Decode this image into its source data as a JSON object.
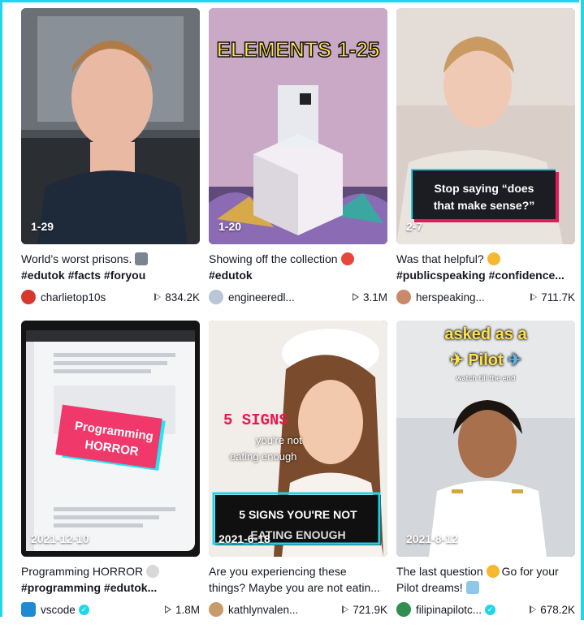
{
  "videos": [
    {
      "overlay": "1-29",
      "desc": "World’s worst prisons.",
      "tags": "#edutok #facts #foryou",
      "author": "charlietop10s",
      "views": "834.2K",
      "verified": false
    },
    {
      "overlay": "1-20",
      "thumb_title": "ELEMENTS 1-25",
      "desc": "Showing off the collection",
      "tags": "#edutok",
      "author": "engineeredl...",
      "views": "3.1M",
      "verified": false
    },
    {
      "overlay": "2-7",
      "thumb_caption_1": "Stop saying “does",
      "thumb_caption_2": "that make sense?”",
      "desc": "Was that helpful?",
      "tags": "#publicspeaking #confidence...",
      "author": "herspeaking...",
      "views": "711.7K",
      "verified": false
    },
    {
      "overlay": "2021-12-10",
      "thumb_caption_1": "Programming",
      "thumb_caption_2": "HORROR",
      "desc": "Programming HORROR",
      "tags": "#programming #edutok...",
      "author": "vscode",
      "views": "1.8M",
      "verified": true
    },
    {
      "overlay": "2021-6-18",
      "thumb_caption_1": "5 SIGNS",
      "thumb_caption_2": "you're not",
      "thumb_caption_3": "eating enough",
      "thumb_caption_4": "5 SIGNS YOU'RE NOT",
      "thumb_caption_5": "EATING ENOUGH",
      "desc": "Are you experiencing these",
      "desc2": "things? Maybe you are not eatin...",
      "author": "kathlynvalen...",
      "views": "721.9K",
      "verified": false
    },
    {
      "overlay": "2021-8-12",
      "thumb_caption_1": "asked as a",
      "thumb_caption_2": "Pilot",
      "thumb_caption_3": "watch till the end",
      "desc": "The last question",
      "desc_b": "Go for your",
      "desc2": "Pilot dreams!",
      "author": "filipinapilotc...",
      "views": "678.2K",
      "verified": true
    }
  ],
  "colors": {
    "accent": "#20d5ec",
    "text": "#161823"
  }
}
